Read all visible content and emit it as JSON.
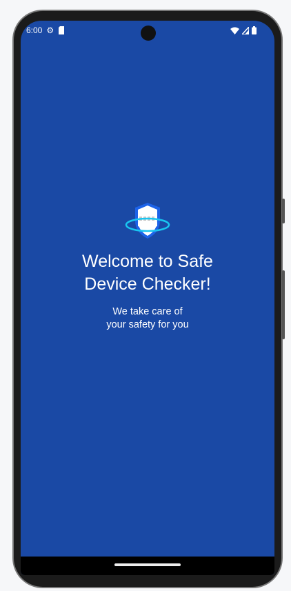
{
  "status_bar": {
    "time": "6:00",
    "icons_left": [
      "settings-icon",
      "sim-card-icon"
    ],
    "icons_right": [
      "wifi-icon",
      "signal-icon",
      "battery-icon"
    ]
  },
  "splash": {
    "title_line1": "Welcome to Safe",
    "title_line2": "Device Checker!",
    "subtitle_line1": "We take care of",
    "subtitle_line2": "your safety for you",
    "icon": "shield-icon"
  },
  "colors": {
    "background": "#1a49a5",
    "ring": "#19c6f0"
  }
}
